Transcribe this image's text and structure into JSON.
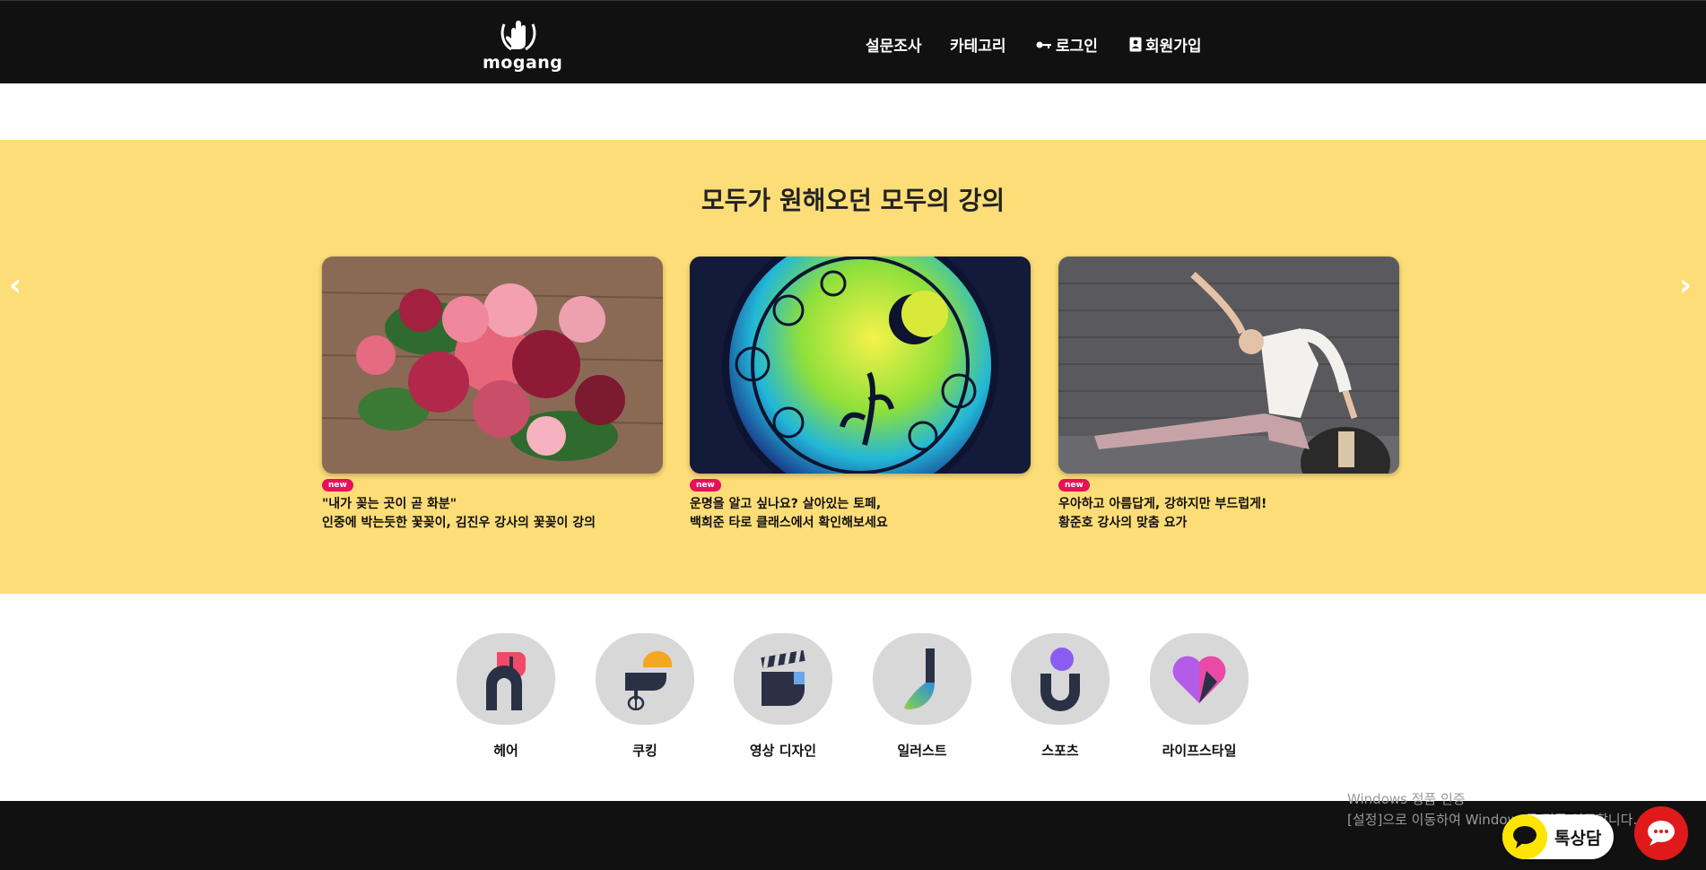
{
  "header": {
    "logo_text": "mogang",
    "nav": [
      {
        "label": "설문조사"
      },
      {
        "label": "카테고리"
      },
      {
        "label": "로그인",
        "icon": "key-icon"
      },
      {
        "label": "회원가입",
        "icon": "id-card-icon"
      }
    ]
  },
  "hero": {
    "title": "모두가 원해오던 모두의 강의",
    "prev_arrow": "‹",
    "next_arrow": "›",
    "cards": [
      {
        "badge": "new",
        "line1": "\"내가 꽂는 곳이 곧 화분\"",
        "line2": "인중에 박는듯한 꽃꽂이, 김진우 강사의 꽃꽂이 강의",
        "image": "flower-bouquet"
      },
      {
        "badge": "new",
        "line1": "운명을 알고 싶나요? 살아있는 토페,",
        "line2": "백희준 타로 클래스에서 확인해보세요",
        "image": "tarot-circle"
      },
      {
        "badge": "new",
        "line1": "우아하고 아름답게, 강하지만 부드럽게!",
        "line2": "황준호 강사의 맞춤 요가",
        "image": "yoga-stretch"
      }
    ]
  },
  "categories": [
    {
      "label": "헤어",
      "icon": "hair-icon"
    },
    {
      "label": "쿠킹",
      "icon": "cooking-mixer-icon"
    },
    {
      "label": "영상 디자인",
      "icon": "clapperboard-icon"
    },
    {
      "label": "일러스트",
      "icon": "illustration-icon"
    },
    {
      "label": "스포츠",
      "icon": "sports-icon"
    },
    {
      "label": "라이프스타일",
      "icon": "heart-icon"
    }
  ],
  "watermark": {
    "line1": "Windows 정품 인증",
    "line2": "[설정]으로 이동하여 Windows를 정품 인증합니다."
  },
  "widgets": {
    "talk_label": "톡상담"
  },
  "colors": {
    "header_bg": "#111111",
    "hero_bg": "#fddd78",
    "badge": "#e8105a",
    "chat_red": "#e01a1a",
    "kakao_yellow": "#fee500"
  }
}
